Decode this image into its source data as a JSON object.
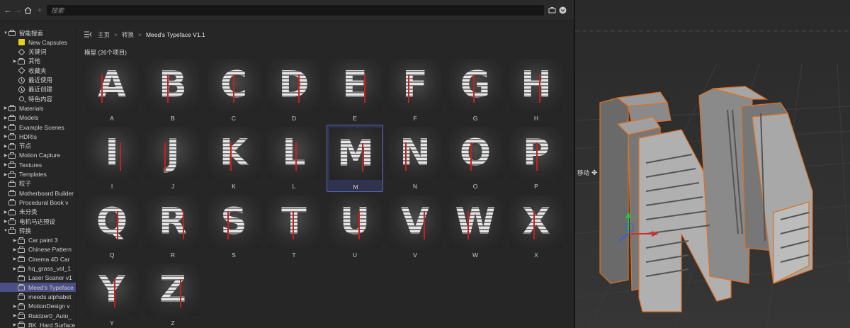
{
  "search": {
    "placeholder": "搜索"
  },
  "tree": [
    {
      "label": "智能搜索",
      "icon": "folder",
      "indent": 0,
      "expanded": true
    },
    {
      "label": "New Capsules",
      "icon": "new-capsule",
      "indent": 1
    },
    {
      "label": "关键词",
      "icon": "tag",
      "indent": 1
    },
    {
      "label": "其他",
      "icon": "folder",
      "indent": 1,
      "collapsed": true
    },
    {
      "label": "收藏夹",
      "icon": "tag",
      "indent": 1
    },
    {
      "label": "最近使用",
      "icon": "clock",
      "indent": 1
    },
    {
      "label": "最近创建",
      "icon": "clock",
      "indent": 1
    },
    {
      "label": "特色内容",
      "icon": "search",
      "indent": 1
    },
    {
      "label": "Materials",
      "icon": "folder",
      "indent": 0,
      "collapsed": true
    },
    {
      "label": "Models",
      "icon": "folder",
      "indent": 0,
      "collapsed": true
    },
    {
      "label": "Example Scenes",
      "icon": "folder",
      "indent": 0,
      "collapsed": true
    },
    {
      "label": "HDRIs",
      "icon": "folder",
      "indent": 0,
      "collapsed": true
    },
    {
      "label": "节点",
      "icon": "folder",
      "indent": 0,
      "collapsed": true
    },
    {
      "label": "Motion Capture",
      "icon": "folder",
      "indent": 0,
      "collapsed": true
    },
    {
      "label": "Textures",
      "icon": "folder",
      "indent": 0,
      "collapsed": true
    },
    {
      "label": "Templates",
      "icon": "folder",
      "indent": 0,
      "collapsed": true
    },
    {
      "label": "粒子",
      "icon": "folder",
      "indent": 0
    },
    {
      "label": "Motherboard Builder",
      "icon": "folder",
      "indent": 0
    },
    {
      "label": "Procedural Book v",
      "icon": "folder",
      "indent": 0
    },
    {
      "label": "未分类",
      "icon": "folder",
      "indent": 0,
      "collapsed": true
    },
    {
      "label": "电机马达预设",
      "icon": "folder",
      "indent": 0,
      "collapsed": true
    },
    {
      "label": "转换",
      "icon": "folder",
      "indent": 0,
      "expanded": true
    },
    {
      "label": "Car paint 3",
      "icon": "folder",
      "indent": 1,
      "collapsed": true
    },
    {
      "label": "Chinese Pattern",
      "icon": "folder",
      "indent": 1,
      "collapsed": true
    },
    {
      "label": "Cinema 4D Car",
      "icon": "folder",
      "indent": 1,
      "collapsed": true
    },
    {
      "label": "hq_grass_vol_1",
      "icon": "folder",
      "indent": 1,
      "collapsed": true
    },
    {
      "label": "Laser Scaner v1",
      "icon": "folder",
      "indent": 1
    },
    {
      "label": "Meed's Typeface",
      "icon": "folder",
      "indent": 1,
      "selected": true
    },
    {
      "label": "meeds alphabet",
      "icon": "folder",
      "indent": 1
    },
    {
      "label": "MotionDesign v",
      "icon": "folder",
      "indent": 1,
      "collapsed": true
    },
    {
      "label": "Raidzer0_Auto_",
      "icon": "folder",
      "indent": 1,
      "collapsed": true
    },
    {
      "label": "BK_Hard Surface",
      "icon": "folder",
      "indent": 1,
      "collapsed": true
    }
  ],
  "breadcrumb": {
    "home": "主页",
    "convert": "转换",
    "current": "Meed's Typeface V1.1"
  },
  "section_title": "模型 (26个项目)",
  "tiles": [
    "A",
    "B",
    "C",
    "D",
    "E",
    "F",
    "G",
    "H",
    "I",
    "J",
    "K",
    "L",
    "M",
    "N",
    "O",
    "P",
    "Q",
    "R",
    "S",
    "T",
    "U",
    "V",
    "W",
    "X",
    "Y",
    "Z"
  ],
  "selected_tile": "M",
  "viewport": {
    "move_label": "移动"
  },
  "colors": {
    "accent": "#4a4f86",
    "selection_outline": "#e07020",
    "red_stripe": "#c42020"
  }
}
